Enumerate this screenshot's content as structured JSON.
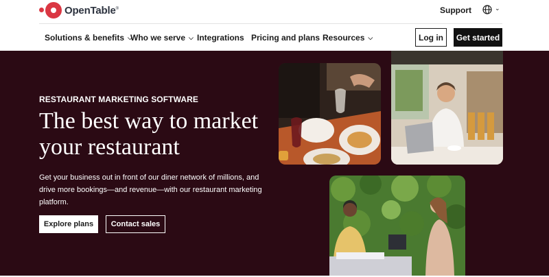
{
  "brand": {
    "name": "OpenTable",
    "trademark": "®",
    "accent": "#da3743"
  },
  "header": {
    "support_label": "Support",
    "language_icon": "globe-icon"
  },
  "nav": {
    "items": [
      {
        "label": "Solutions & benefits",
        "has_dropdown": true
      },
      {
        "label": "Who we serve",
        "has_dropdown": true
      },
      {
        "label": "Integrations",
        "has_dropdown": false
      },
      {
        "label": "Pricing and plans",
        "has_dropdown": false
      },
      {
        "label": "Resources",
        "has_dropdown": true
      }
    ],
    "login_label": "Log in",
    "get_started_label": "Get started"
  },
  "hero": {
    "background": "#2b0a14",
    "eyebrow": "RESTAURANT MARKETING SOFTWARE",
    "headline": "The best way to market your restaurant",
    "subtext": "Get your business out in front of our diner network of millions, and drive more bookings—and revenue—with our restaurant marketing platform.",
    "explore_label": "Explore plans",
    "contact_label": "Contact sales"
  }
}
